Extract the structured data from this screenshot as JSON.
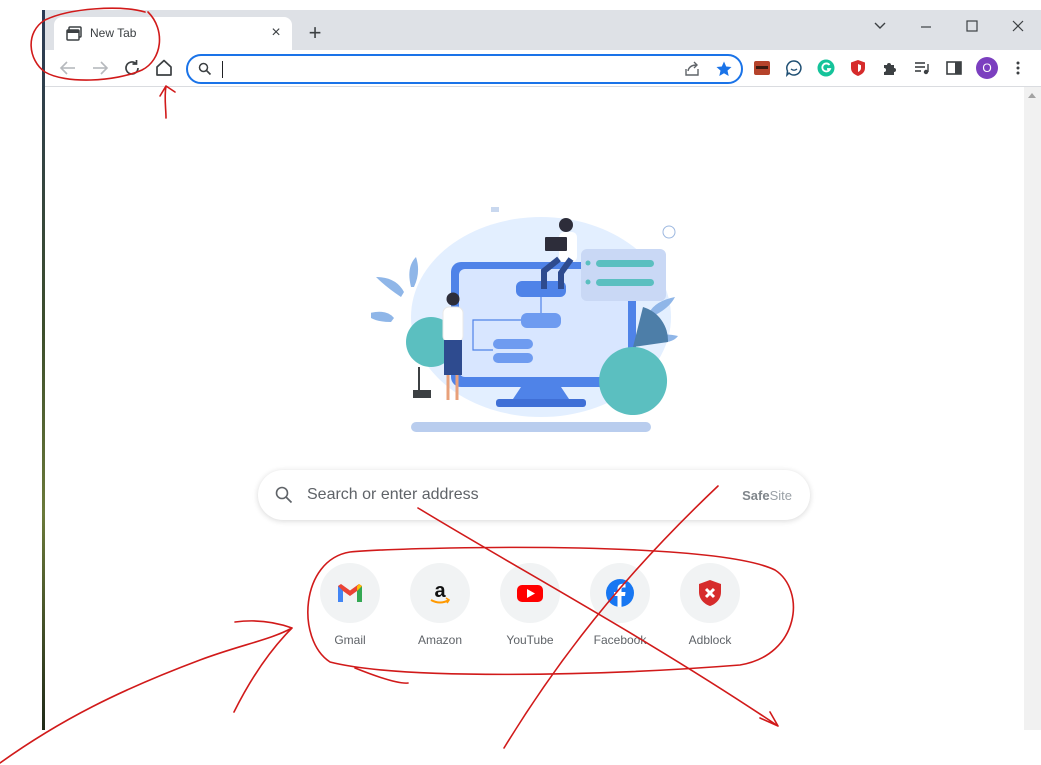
{
  "tab": {
    "title": "New Tab",
    "close_glyph": "×"
  },
  "tabstrip": {
    "new_tab_glyph": "+"
  },
  "toolbar": {
    "back": "back-arrow-icon",
    "forward": "forward-arrow-icon",
    "reload": "reload-icon",
    "home": "home-icon",
    "address_value": "",
    "share": "share-icon",
    "bookmark": "star-icon",
    "extensions": [
      "password-manager-icon",
      "chat-icon",
      "grammarly-icon",
      "shield-icon",
      "puzzle-icon",
      "media-queue-icon",
      "side-panel-icon"
    ],
    "profile_initial": "O",
    "menu": "kebab-menu-icon"
  },
  "colors": {
    "accent": "#1a73e8",
    "profile": "#7b3fbf",
    "annotation": "#d11a1a"
  },
  "search": {
    "placeholder": "Search or enter address",
    "brand_bold": "Safe",
    "brand_rest": "Site"
  },
  "shortcuts": [
    {
      "label": "Gmail",
      "icon": "gmail-icon"
    },
    {
      "label": "Amazon",
      "icon": "amazon-icon"
    },
    {
      "label": "YouTube",
      "icon": "youtube-icon"
    },
    {
      "label": "Facebook",
      "icon": "facebook-icon"
    },
    {
      "label": "Adblock",
      "icon": "adblock-shield-icon"
    }
  ]
}
